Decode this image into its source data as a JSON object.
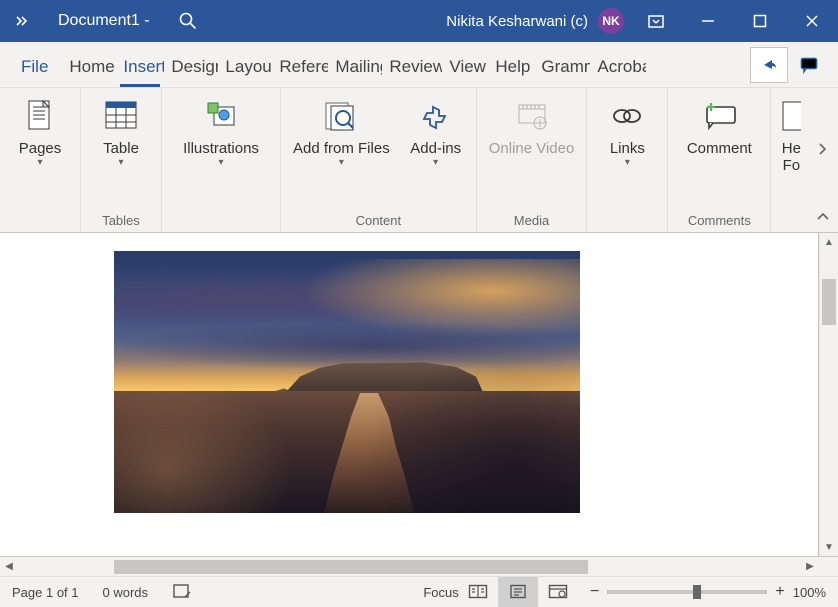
{
  "titlebar": {
    "doc_title": "Document1  -",
    "user_name": "Nikita Kesharwani (c)",
    "user_initials": "NK"
  },
  "tabs": {
    "file": "File",
    "items": [
      "Home",
      "Insert",
      "Design",
      "Layout",
      "References",
      "Mailings",
      "Review",
      "View",
      "Help",
      "Grammarly",
      "Acrobat"
    ],
    "widths": [
      54,
      48,
      54,
      54,
      56,
      54,
      60,
      46,
      46,
      56,
      56
    ],
    "active_index": 1
  },
  "ribbon": {
    "pages": "Pages",
    "table": "Table",
    "illustrations": "Illustrations",
    "add_from_files": "Add from Files",
    "addins": "Add-ins",
    "online_video": "Online Video",
    "links": "Links",
    "comment": "Comment",
    "header_footer_1": "He",
    "header_footer_2": "Fo",
    "group_tables": "Tables",
    "group_content": "Content",
    "group_media": "Media",
    "group_comments": "Comments"
  },
  "status": {
    "page": "Page 1 of 1",
    "words": "0 words",
    "focus": "Focus",
    "zoom": "100%"
  }
}
